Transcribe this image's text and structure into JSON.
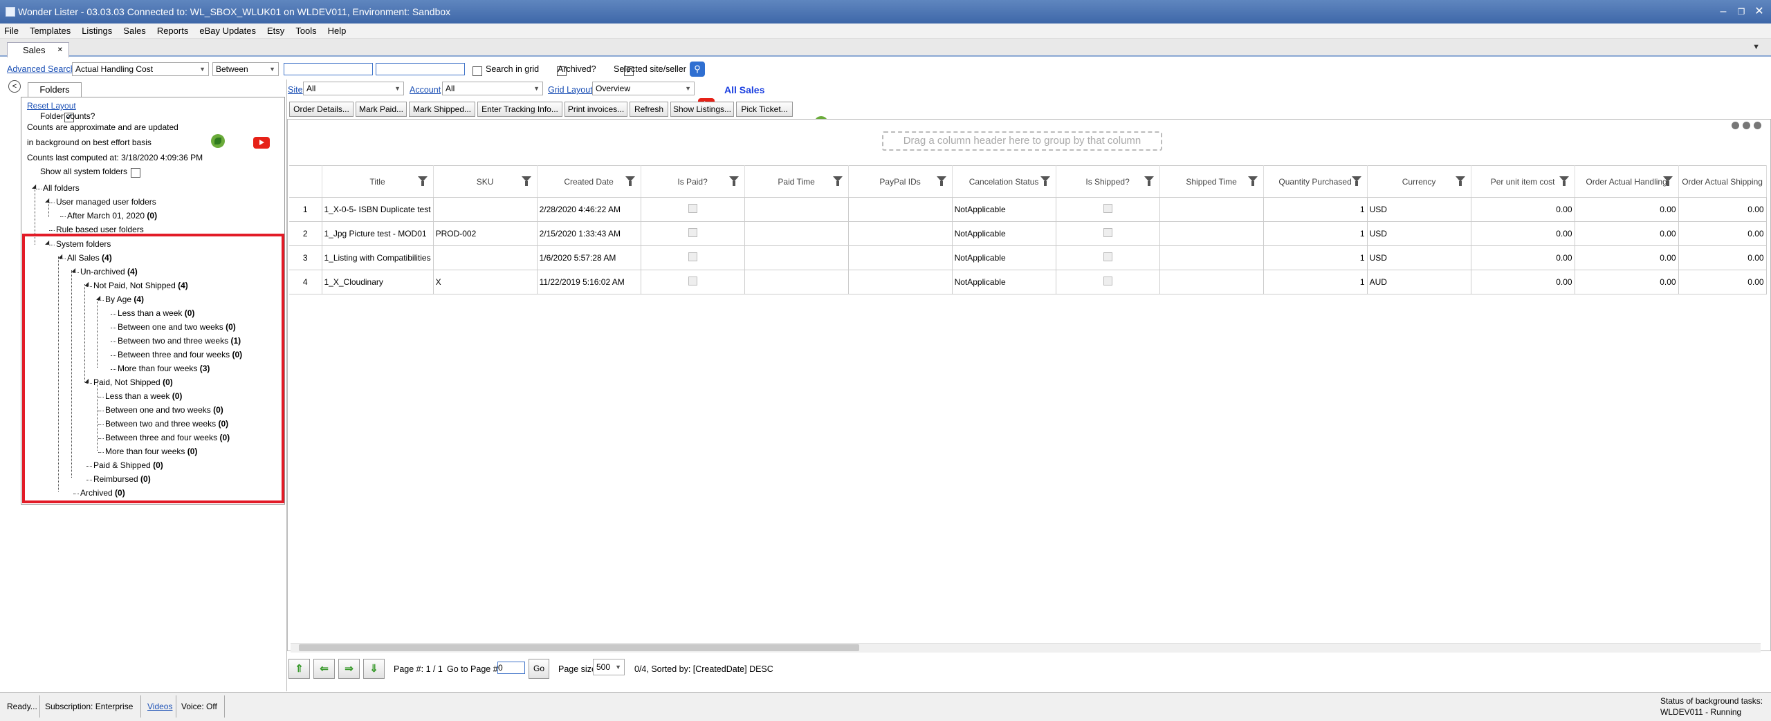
{
  "window": {
    "title": "Wonder Lister - 03.03.03 Connected to: WL_SBOX_WLUK01 on WLDEV011, Environment: Sandbox"
  },
  "menu": [
    "File",
    "Templates",
    "Listings",
    "Sales",
    "Reports",
    "eBay Updates",
    "Etsy",
    "Tools",
    "Help"
  ],
  "tab": {
    "label": "Sales",
    "close": "✕"
  },
  "search": {
    "advanced_label": "Advanced Search",
    "field": "Actual Handling Cost",
    "operator": "Between",
    "value1": "",
    "value2": "",
    "search_in_grid": "Search in grid",
    "archived": "Archived?",
    "selected_site": "Selected site/seller",
    "search_in_grid_checked": false,
    "archived_checked": false,
    "selected_site_checked": true
  },
  "left": {
    "tab": "Folders",
    "reset_layout": "Reset Layout",
    "folder_counts": "Folder counts?",
    "note1": "Counts are approximate and are updated",
    "note2": "in background on best effort basis",
    "last_computed": "Counts last computed at: 3/18/2020 4:09:36 PM",
    "show_all": "Show all system folders",
    "tree": [
      {
        "label": "All folders",
        "count": ""
      },
      {
        "label": "User managed user folders",
        "count": ""
      },
      {
        "label": "After March 01, 2020",
        "count": "(0)"
      },
      {
        "label": "Rule based user folders",
        "count": ""
      },
      {
        "label": "System folders",
        "count": ""
      },
      {
        "label": "All Sales",
        "count": "(4)"
      },
      {
        "label": "Un-archived",
        "count": "(4)"
      },
      {
        "label": "Not Paid, Not Shipped",
        "count": "(4)"
      },
      {
        "label": "By Age",
        "count": "(4)"
      },
      {
        "label": "Less than a week",
        "count": "(0)"
      },
      {
        "label": "Between one and two weeks",
        "count": "(0)"
      },
      {
        "label": "Between two and three weeks",
        "count": "(1)"
      },
      {
        "label": "Between three and four weeks",
        "count": "(0)"
      },
      {
        "label": "More than four weeks",
        "count": "(3)"
      },
      {
        "label": "Paid, Not Shipped",
        "count": "(0)"
      },
      {
        "label": "Less than a week",
        "count": "(0)"
      },
      {
        "label": "Between one and two weeks",
        "count": "(0)"
      },
      {
        "label": "Between two and three weeks",
        "count": "(0)"
      },
      {
        "label": "Between three and four weeks",
        "count": "(0)"
      },
      {
        "label": "More than four weeks",
        "count": "(0)"
      },
      {
        "label": "Paid & Shipped",
        "count": "(0)"
      },
      {
        "label": "Reimbursed",
        "count": "(0)"
      },
      {
        "label": "Archived",
        "count": "(0)"
      }
    ]
  },
  "filters": {
    "site_label": "Site",
    "site_value": "All",
    "account_label": "Account",
    "account_value": "All",
    "layout_label": "Grid Layout",
    "layout_value": "Overview",
    "heading": "All Sales"
  },
  "actions": [
    "Order Details...",
    "Mark Paid...",
    "Mark Shipped...",
    "Enter Tracking Info...",
    "Print invoices...",
    "Refresh",
    "Show Listings...",
    "Pick Ticket..."
  ],
  "grid": {
    "group_hint": "Drag a column header here to group by that column",
    "columns": [
      "Title",
      "SKU",
      "Created Date",
      "Is Paid?",
      "Paid Time",
      "PayPal IDs",
      "Cancelation Status",
      "Is Shipped?",
      "Shipped Time",
      "Quantity Purchased",
      "Currency",
      "Per unit item cost",
      "Order Actual Handling",
      "Order Actual Shipping"
    ],
    "rows": [
      {
        "n": "1",
        "title": "1_X-0-5- ISBN Duplicate test",
        "sku": "",
        "created": "2/28/2020 4:46:22 AM",
        "cancel": "NotApplicable",
        "qty": "1",
        "currency": "USD",
        "cost": "0.00",
        "handling": "0.00",
        "shipping": "0.00"
      },
      {
        "n": "2",
        "title": "1_Jpg Picture test - MOD01",
        "sku": "PROD-002",
        "created": "2/15/2020 1:33:43 AM",
        "cancel": "NotApplicable",
        "qty": "1",
        "currency": "USD",
        "cost": "0.00",
        "handling": "0.00",
        "shipping": "0.00"
      },
      {
        "n": "3",
        "title": "1_Listing with Compatibilities",
        "sku": "",
        "created": "1/6/2020 5:57:28 AM",
        "cancel": "NotApplicable",
        "qty": "1",
        "currency": "USD",
        "cost": "0.00",
        "handling": "0.00",
        "shipping": "0.00"
      },
      {
        "n": "4",
        "title": "1_X_Cloudinary",
        "sku": "X",
        "created": "11/22/2019 5:16:02 AM",
        "cancel": "NotApplicable",
        "qty": "1",
        "currency": "AUD",
        "cost": "0.00",
        "handling": "0.00",
        "shipping": "0.00"
      }
    ]
  },
  "pager": {
    "page_label": "Page #: 1 / 1",
    "goto_label": "Go to Page #:",
    "goto_value": "0",
    "go": "Go",
    "size_label": "Page size:",
    "size_value": "500",
    "summary": "0/4, Sorted by: [CreatedDate] DESC"
  },
  "status": {
    "ready": "Ready...",
    "subscription": "Subscription: Enterprise",
    "videos": "Videos",
    "voice": "Voice:  Off",
    "bg_title": "Status of background tasks:",
    "bg_value": "WLDEV011 - Running"
  },
  "colors": {
    "accent": "#3e67a8",
    "highlight": "#e21b27",
    "link": "#1a4fb5"
  }
}
